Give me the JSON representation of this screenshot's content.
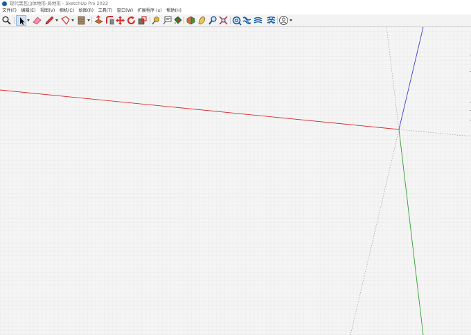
{
  "window": {
    "title": "现代黑瓦山体地形-局地形 - SketchUp Pro 2022"
  },
  "menu": [
    {
      "label": "文件(F)"
    },
    {
      "label": "编辑(E)"
    },
    {
      "label": "视图(V)"
    },
    {
      "label": "相机(C)"
    },
    {
      "label": "绘图(R)"
    },
    {
      "label": "工具(T)"
    },
    {
      "label": "窗口(W)"
    },
    {
      "label": "扩展程序 (x)"
    },
    {
      "label": "帮助(H)"
    }
  ],
  "toolbar": {
    "tools": [
      {
        "name": "search-icon"
      },
      {
        "name": "select-arrow-icon",
        "active": true
      },
      {
        "name": "eraser-icon"
      },
      {
        "name": "pencil-icon"
      },
      {
        "name": "shape-icon"
      },
      {
        "name": "wall-icon"
      },
      {
        "name": "push-pull-icon"
      },
      {
        "name": "follow-me-icon"
      },
      {
        "name": "move-icon"
      },
      {
        "name": "rotate-icon"
      },
      {
        "name": "scale-icon"
      },
      {
        "name": "tape-measure-icon"
      },
      {
        "name": "text-label-icon"
      },
      {
        "name": "paint-bucket-icon"
      },
      {
        "name": "section-plane-icon"
      },
      {
        "name": "walk-icon"
      },
      {
        "name": "zoom-icon"
      },
      {
        "name": "zoom-extents-icon"
      },
      {
        "name": "sandbox-scratch-icon"
      },
      {
        "name": "sandbox-smoove-icon"
      },
      {
        "name": "sandbox-stamp-icon"
      },
      {
        "name": "sandbox-flip-icon"
      },
      {
        "name": "profile-icon"
      }
    ]
  },
  "viewport": {
    "axis_colors": {
      "red": "#d62b2b",
      "green": "#2f9e2f",
      "blue": "#3b3bd6",
      "dotted": "#8a8a8a"
    },
    "background": "#f5f5f5"
  }
}
